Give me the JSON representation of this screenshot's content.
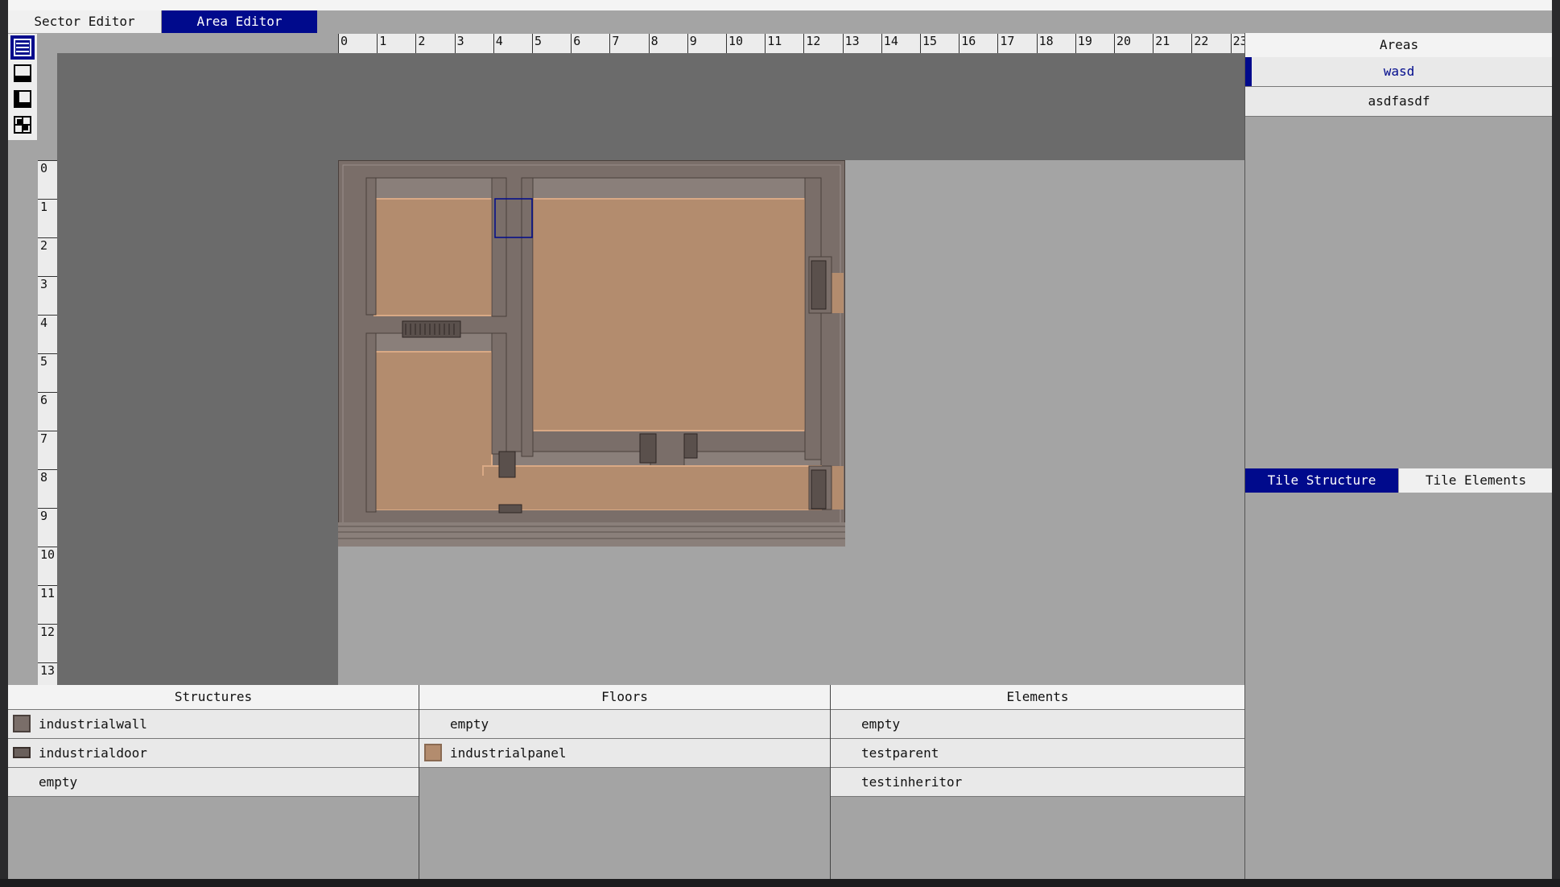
{
  "tabs": [
    {
      "label": "Sector Editor",
      "active": false
    },
    {
      "label": "Area Editor",
      "active": true
    }
  ],
  "toolbar": [
    "list-icon",
    "window-icon",
    "corner-icon",
    "tile-grid-icon"
  ],
  "ruler": {
    "x": [
      "0",
      "1",
      "2",
      "3",
      "4",
      "5",
      "6",
      "7",
      "8",
      "9",
      "10",
      "11",
      "12",
      "13",
      "14",
      "15",
      "16",
      "17",
      "18",
      "19",
      "20",
      "21",
      "22",
      "23"
    ],
    "y": [
      "0",
      "1",
      "2",
      "3",
      "4",
      "5",
      "6",
      "7",
      "8",
      "9",
      "10",
      "11",
      "12",
      "13"
    ]
  },
  "areas": {
    "title": "Areas",
    "items": [
      {
        "label": "wasd",
        "selected": true
      },
      {
        "label": "asdfasdf",
        "selected": false
      }
    ]
  },
  "tile_tabs": [
    {
      "label": "Tile Structure",
      "active": true
    },
    {
      "label": "Tile Elements",
      "active": false
    }
  ],
  "structures": {
    "title": "Structures",
    "items": [
      {
        "label": "industrialwall",
        "icon": "wall-icon"
      },
      {
        "label": "industrialdoor",
        "icon": "door-icon"
      },
      {
        "label": "empty",
        "icon": ""
      }
    ]
  },
  "floors": {
    "title": "Floors",
    "items": [
      {
        "label": "empty",
        "icon": ""
      },
      {
        "label": "industrialpanel",
        "icon": "panel-icon"
      }
    ]
  },
  "elements": {
    "title": "Elements",
    "items": [
      {
        "label": "empty"
      },
      {
        "label": "testparent"
      },
      {
        "label": "testinheritor"
      }
    ]
  },
  "colors": {
    "accent": "#000a8c",
    "floor": "#b38c6e",
    "wall": "#7a6e69",
    "viewport": "#6b6b6b",
    "panel": "#a4a4a4"
  }
}
